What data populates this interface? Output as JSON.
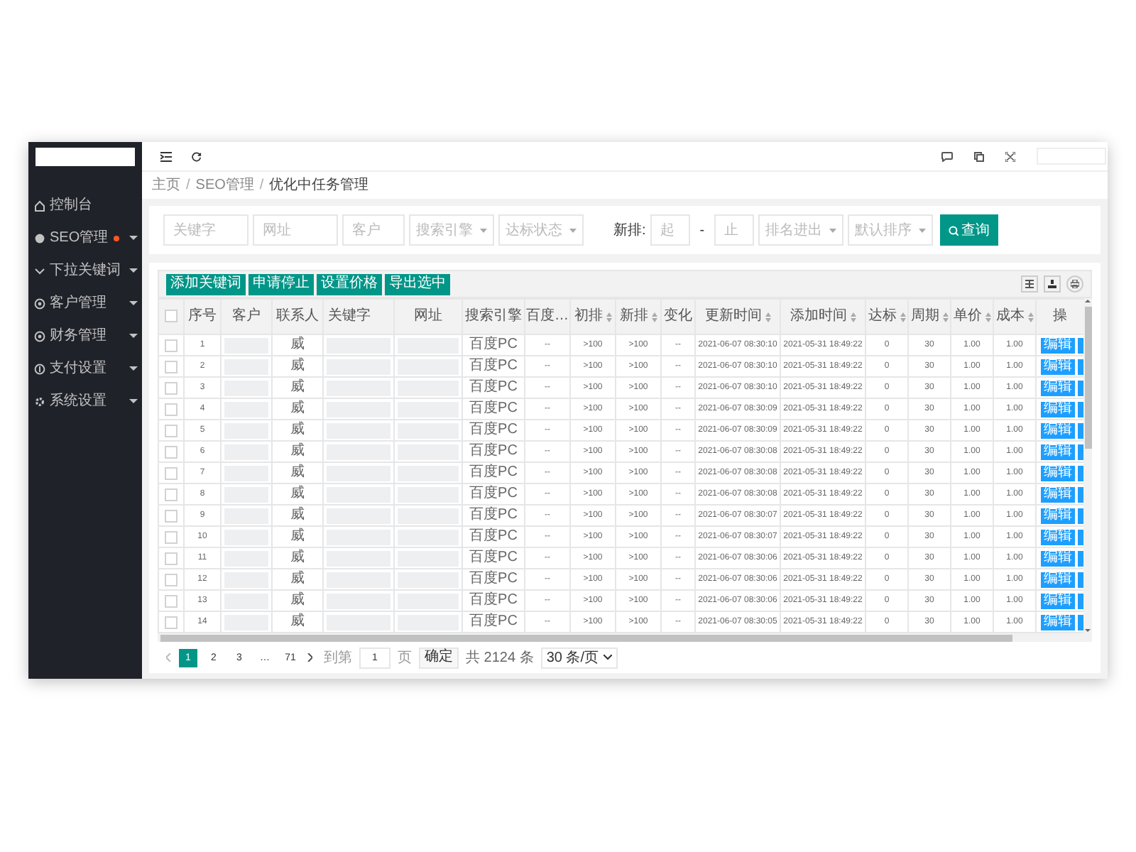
{
  "sidebar": {
    "items": [
      {
        "label": "控制台",
        "expandable": false,
        "dot": false
      },
      {
        "label": "SEO管理",
        "expandable": true,
        "dot": true
      },
      {
        "label": "下拉关键词",
        "expandable": true,
        "dot": false
      },
      {
        "label": "客户管理",
        "expandable": true,
        "dot": false
      },
      {
        "label": "财务管理",
        "expandable": true,
        "dot": false
      },
      {
        "label": "支付设置",
        "expandable": true,
        "dot": false
      },
      {
        "label": "系统设置",
        "expandable": true,
        "dot": false
      }
    ]
  },
  "breadcrumb": {
    "items": [
      "主页",
      "SEO管理",
      "优化中任务管理"
    ],
    "separators": [
      "/",
      "/"
    ]
  },
  "filters": [
    {
      "kind": "input",
      "placeholder": "关键字"
    },
    {
      "kind": "input",
      "placeholder": "网址"
    },
    {
      "kind": "input",
      "placeholder": "客户"
    },
    {
      "kind": "select",
      "placeholder": "搜索引擎"
    },
    {
      "kind": "select",
      "placeholder": "达标状态"
    },
    {
      "kind": "label",
      "text": "新排:"
    },
    {
      "kind": "input",
      "placeholder": "起"
    },
    {
      "kind": "text",
      "text": "-"
    },
    {
      "kind": "input",
      "placeholder": "止"
    },
    {
      "kind": "select",
      "placeholder": "排名进出"
    },
    {
      "kind": "select",
      "placeholder": "默认排序"
    },
    {
      "kind": "button",
      "text": "查询"
    }
  ],
  "toolbar": {
    "buttons": [
      "添加关键词",
      "申请停止",
      "设置价格",
      "导出选中"
    ]
  },
  "table": {
    "select_all_checked": false,
    "columns": [
      {
        "label": "序号",
        "sortable": false
      },
      {
        "label": "客户",
        "sortable": false
      },
      {
        "label": "联系人",
        "sortable": false
      },
      {
        "label": "关键字",
        "sortable": false
      },
      {
        "label": "网址",
        "sortable": false
      },
      {
        "label": "搜索引擎",
        "sortable": false
      },
      {
        "label": "百度…",
        "sortable": false
      },
      {
        "label": "初排",
        "sortable": true
      },
      {
        "label": "新排",
        "sortable": true
      },
      {
        "label": "变化",
        "sortable": false
      },
      {
        "label": "更新时间",
        "sortable": true
      },
      {
        "label": "添加时间",
        "sortable": true
      },
      {
        "label": "达标",
        "sortable": true
      },
      {
        "label": "周期",
        "sortable": true
      },
      {
        "label": "单价",
        "sortable": true
      },
      {
        "label": "成本",
        "sortable": true
      },
      {
        "label": "操",
        "sortable": false
      }
    ],
    "rows": [
      {
        "checked": false,
        "no": "1",
        "contact": "威",
        "engine": "百度PC",
        "baidu": "--",
        "first_rank": ">100",
        "new_rank": ">100",
        "change": "--",
        "updated": "2021-06-07 08:30:10",
        "added": "2021-05-31 18:49:22",
        "reached": "0",
        "period": "30",
        "price": "1.00",
        "cost": "1.00",
        "action": "编辑"
      },
      {
        "checked": false,
        "no": "2",
        "contact": "威",
        "engine": "百度PC",
        "baidu": "--",
        "first_rank": ">100",
        "new_rank": ">100",
        "change": "--",
        "updated": "2021-06-07 08:30:10",
        "added": "2021-05-31 18:49:22",
        "reached": "0",
        "period": "30",
        "price": "1.00",
        "cost": "1.00",
        "action": "编辑"
      },
      {
        "checked": false,
        "no": "3",
        "contact": "威",
        "engine": "百度PC",
        "baidu": "--",
        "first_rank": ">100",
        "new_rank": ">100",
        "change": "--",
        "updated": "2021-06-07 08:30:10",
        "added": "2021-05-31 18:49:22",
        "reached": "0",
        "period": "30",
        "price": "1.00",
        "cost": "1.00",
        "action": "编辑"
      },
      {
        "checked": false,
        "no": "4",
        "contact": "威",
        "engine": "百度PC",
        "baidu": "--",
        "first_rank": ">100",
        "new_rank": ">100",
        "change": "--",
        "updated": "2021-06-07 08:30:09",
        "added": "2021-05-31 18:49:22",
        "reached": "0",
        "period": "30",
        "price": "1.00",
        "cost": "1.00",
        "action": "编辑"
      },
      {
        "checked": false,
        "no": "5",
        "contact": "威",
        "engine": "百度PC",
        "baidu": "--",
        "first_rank": ">100",
        "new_rank": ">100",
        "change": "--",
        "updated": "2021-06-07 08:30:09",
        "added": "2021-05-31 18:49:22",
        "reached": "0",
        "period": "30",
        "price": "1.00",
        "cost": "1.00",
        "action": "编辑"
      },
      {
        "checked": false,
        "no": "6",
        "contact": "威",
        "engine": "百度PC",
        "baidu": "--",
        "first_rank": ">100",
        "new_rank": ">100",
        "change": "--",
        "updated": "2021-06-07 08:30:08",
        "added": "2021-05-31 18:49:22",
        "reached": "0",
        "period": "30",
        "price": "1.00",
        "cost": "1.00",
        "action": "编辑"
      },
      {
        "checked": false,
        "no": "7",
        "contact": "威",
        "engine": "百度PC",
        "baidu": "--",
        "first_rank": ">100",
        "new_rank": ">100",
        "change": "--",
        "updated": "2021-06-07 08:30:08",
        "added": "2021-05-31 18:49:22",
        "reached": "0",
        "period": "30",
        "price": "1.00",
        "cost": "1.00",
        "action": "编辑"
      },
      {
        "checked": false,
        "no": "8",
        "contact": "威",
        "engine": "百度PC",
        "baidu": "--",
        "first_rank": ">100",
        "new_rank": ">100",
        "change": "--",
        "updated": "2021-06-07 08:30:08",
        "added": "2021-05-31 18:49:22",
        "reached": "0",
        "period": "30",
        "price": "1.00",
        "cost": "1.00",
        "action": "编辑"
      },
      {
        "checked": false,
        "no": "9",
        "contact": "威",
        "engine": "百度PC",
        "baidu": "--",
        "first_rank": ">100",
        "new_rank": ">100",
        "change": "--",
        "updated": "2021-06-07 08:30:07",
        "added": "2021-05-31 18:49:22",
        "reached": "0",
        "period": "30",
        "price": "1.00",
        "cost": "1.00",
        "action": "编辑"
      },
      {
        "checked": false,
        "no": "10",
        "contact": "威",
        "engine": "百度PC",
        "baidu": "--",
        "first_rank": ">100",
        "new_rank": ">100",
        "change": "--",
        "updated": "2021-06-07 08:30:07",
        "added": "2021-05-31 18:49:22",
        "reached": "0",
        "period": "30",
        "price": "1.00",
        "cost": "1.00",
        "action": "编辑"
      },
      {
        "checked": false,
        "no": "11",
        "contact": "威",
        "engine": "百度PC",
        "baidu": "--",
        "first_rank": ">100",
        "new_rank": ">100",
        "change": "--",
        "updated": "2021-06-07 08:30:06",
        "added": "2021-05-31 18:49:22",
        "reached": "0",
        "period": "30",
        "price": "1.00",
        "cost": "1.00",
        "action": "编辑"
      },
      {
        "checked": false,
        "no": "12",
        "contact": "威",
        "engine": "百度PC",
        "baidu": "--",
        "first_rank": ">100",
        "new_rank": ">100",
        "change": "--",
        "updated": "2021-06-07 08:30:06",
        "added": "2021-05-31 18:49:22",
        "reached": "0",
        "period": "30",
        "price": "1.00",
        "cost": "1.00",
        "action": "编辑"
      },
      {
        "checked": false,
        "no": "13",
        "contact": "威",
        "engine": "百度PC",
        "baidu": "--",
        "first_rank": ">100",
        "new_rank": ">100",
        "change": "--",
        "updated": "2021-06-07 08:30:06",
        "added": "2021-05-31 18:49:22",
        "reached": "0",
        "period": "30",
        "price": "1.00",
        "cost": "1.00",
        "action": "编辑"
      },
      {
        "checked": false,
        "no": "14",
        "contact": "威",
        "engine": "百度PC",
        "baidu": "--",
        "first_rank": ">100",
        "new_rank": ">100",
        "change": "--",
        "updated": "2021-06-07 08:30:05",
        "added": "2021-05-31 18:49:22",
        "reached": "0",
        "period": "30",
        "price": "1.00",
        "cost": "1.00",
        "action": "编辑"
      }
    ]
  },
  "pagination": {
    "pages": [
      {
        "label": "1",
        "selected": true
      },
      {
        "label": "2",
        "selected": false
      },
      {
        "label": "3",
        "selected": false
      },
      {
        "label": "…",
        "selected": false
      },
      {
        "label": "71",
        "selected": false
      }
    ],
    "goto_label": "到第",
    "goto_value": "1",
    "page_label": "页",
    "confirm": "确定",
    "total": "共 2124 条",
    "page_size": "30 条/页"
  }
}
